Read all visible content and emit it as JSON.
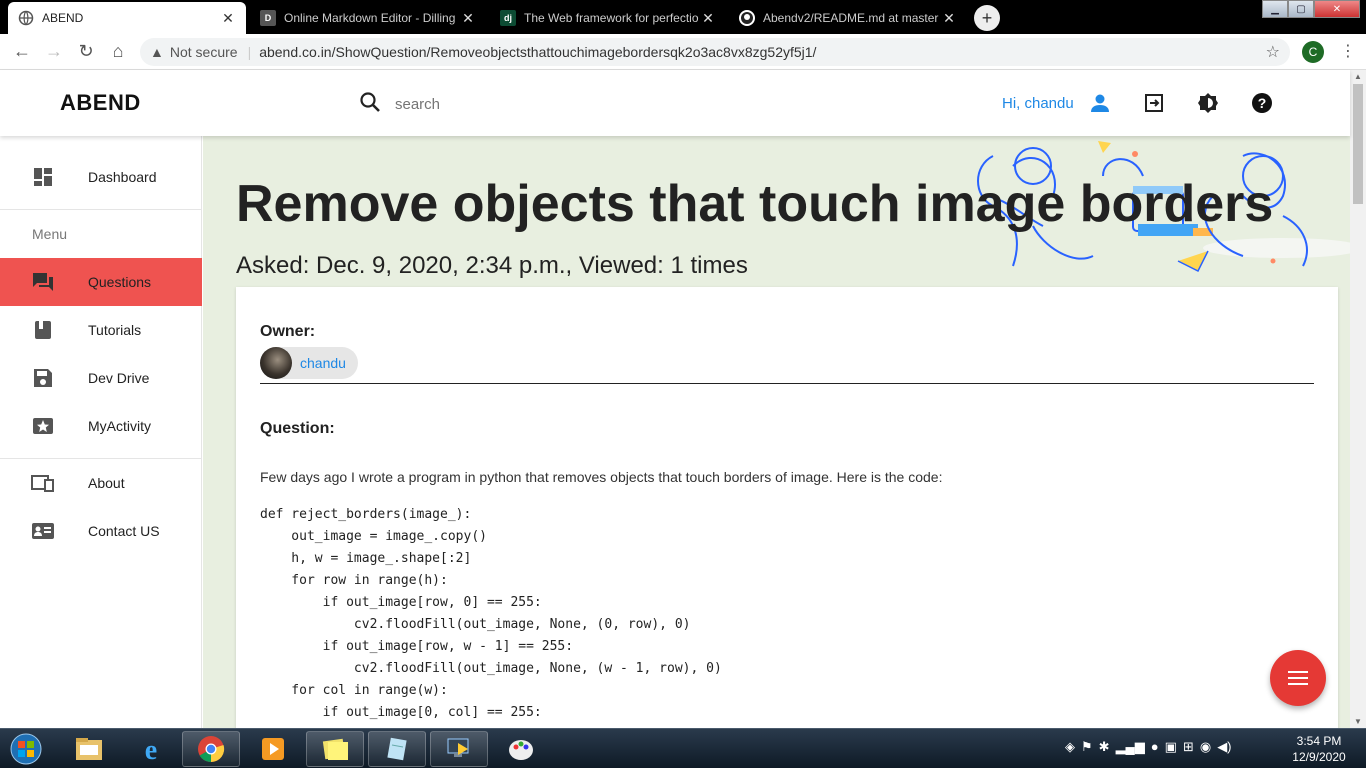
{
  "browser": {
    "tabs": [
      {
        "title": "ABEND",
        "icon": "globe-icon",
        "active": true
      },
      {
        "title": "Online Markdown Editor - Dilling",
        "icon": "d-logo-icon",
        "active": false
      },
      {
        "title": "The Web framework for perfectio",
        "icon": "django-icon",
        "active": false
      },
      {
        "title": "Abendv2/README.md at master",
        "icon": "github-icon",
        "active": false
      }
    ],
    "new_tab_label": "+",
    "security_label": "Not secure",
    "url": "abend.co.in/ShowQuestion/Removeobjectsthattouchimagebordersqk2o3ac8vx8zg52yf5j1/",
    "profile_initial": "C"
  },
  "header": {
    "brand": "ABEND",
    "search_placeholder": "search",
    "greeting": "Hi, chandu"
  },
  "sidebar": {
    "items": [
      {
        "label": "Dashboard",
        "icon": "dashboard-icon"
      },
      {
        "label": "Questions",
        "icon": "forum-icon",
        "active": true
      },
      {
        "label": "Tutorials",
        "icon": "book-icon"
      },
      {
        "label": "Dev Drive",
        "icon": "save-icon"
      },
      {
        "label": "MyActivity",
        "icon": "star-activity-icon"
      },
      {
        "label": "About",
        "icon": "devices-icon"
      },
      {
        "label": "Contact US",
        "icon": "contact-card-icon"
      }
    ],
    "menu_heading": "Menu"
  },
  "question": {
    "title": "Remove objects that touch image borders",
    "meta": "Asked: Dec. 9, 2020, 2:34 p.m., Viewed: 1 times",
    "owner_label": "Owner:",
    "owner_name": "chandu",
    "question_label": "Question:",
    "intro": "Few days ago I wrote a program in python that removes objects that touch borders of image. Here is the code:",
    "code": "def reject_borders(image_):\n    out_image = image_.copy()\n    h, w = image_.shape[:2]\n    for row in range(h):\n        if out_image[row, 0] == 255:\n            cv2.floodFill(out_image, None, (0, row), 0)\n        if out_image[row, w - 1] == 255:\n            cv2.floodFill(out_image, None, (w - 1, row), 0)\n    for col in range(w):\n        if out_image[0, col] == 255:"
  },
  "taskbar": {
    "time": "3:54 PM",
    "date": "12/9/2020"
  },
  "colors": {
    "accent": "#1e88e5",
    "active_item": "#ef5350",
    "fab": "#e53935",
    "main_bg": "#e8efe0"
  }
}
